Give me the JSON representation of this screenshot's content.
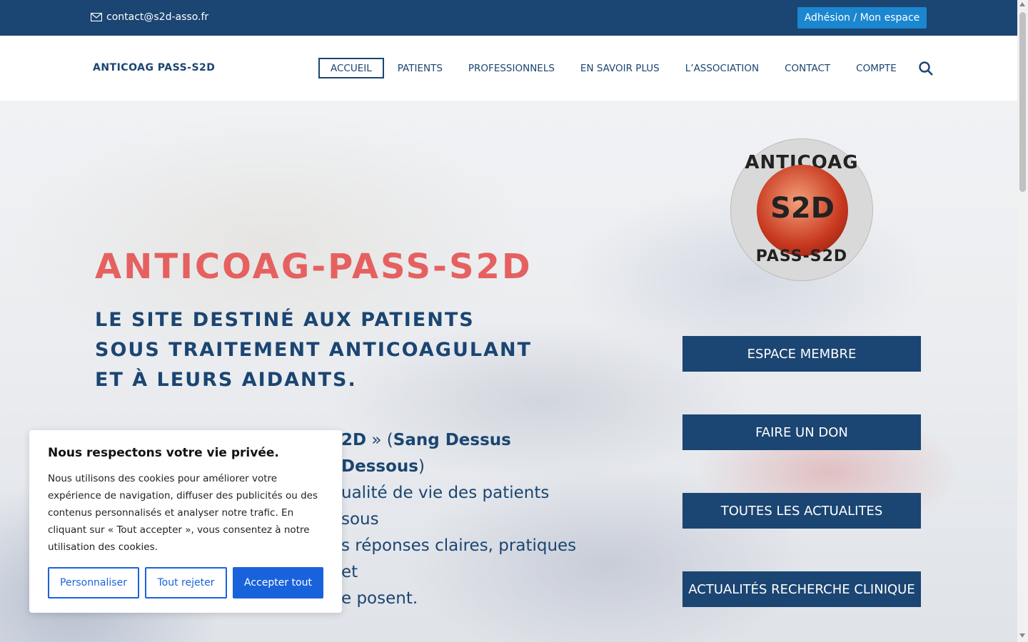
{
  "topbar": {
    "email": "contact@s2d-asso.fr",
    "email_icon": "envelope-icon",
    "member_button": "Adhésion / Mon espace"
  },
  "header": {
    "logo": "ANTICOAG PASS-S2D",
    "nav": [
      {
        "label": "ACCUEIL",
        "active": true
      },
      {
        "label": "PATIENTS"
      },
      {
        "label": "PROFESSIONNELS"
      },
      {
        "label": "EN SAVOIR PLUS"
      },
      {
        "label": "L’ASSOCIATION"
      },
      {
        "label": "CONTACT"
      },
      {
        "label": "COMPTE"
      }
    ],
    "search_icon": "search-icon"
  },
  "hero": {
    "title": "ANTICOAG-PASS-S2D",
    "subtitle_lines": [
      "LE SITE DESTINÉ AUX PATIENTS",
      "SOUS TRAITEMENT ANTICOAGULANT",
      "ET À LEURS AIDANTS."
    ],
    "body_line1_bold": "2D",
    "body_line1_mid": " » (",
    "body_line1_bold2": "Sang Dessus Dessous",
    "body_line1_end": ")",
    "body_line2": "ualité de vie des patients sous",
    "body_line3": "s réponses claires, pratiques et",
    "body_line4": "e posent.",
    "badge_top": "ANTICOAG",
    "badge_bottom": "PASS-S2D",
    "badge_center": "S2D",
    "buttons": [
      "ESPACE MEMBRE",
      "FAIRE UN DON",
      "TOUTES LES ACTUALITES",
      "ACTUALITÉS RECHERCHE CLINIQUE"
    ]
  },
  "cookie": {
    "title": "Nous respectons votre vie privée.",
    "text": "Nous utilisons des cookies pour améliorer votre expérience de navigation, diffuser des publicités ou des contenus personnalisés et analyser notre trafic. En cliquant sur « Tout accepter », vous consentez à notre utilisation des cookies.",
    "customize": "Personnaliser",
    "reject": "Tout rejeter",
    "accept": "Accepter tout"
  },
  "colors": {
    "navy": "#1b4572",
    "accent_blue": "#1a87d0",
    "title_red": "#e56160",
    "cookie_blue": "#1863dc"
  }
}
